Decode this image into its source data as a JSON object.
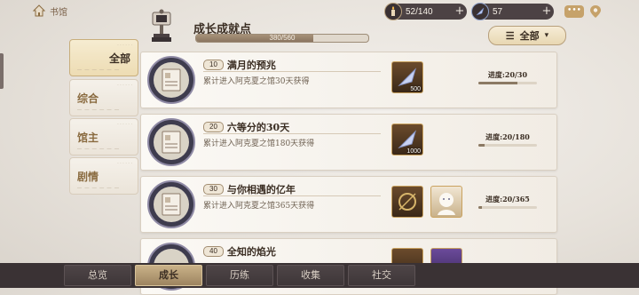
{
  "header": {
    "back_label": "书馆",
    "title": "成长成就点",
    "points_text": "380/560",
    "points_progress": 0.679,
    "filter_label": "全部"
  },
  "resources": [
    {
      "icon": "candle-icon",
      "value": "52/140"
    },
    {
      "icon": "feather-crystal-icon",
      "value": "57"
    }
  ],
  "chat_label": "•••",
  "tabs": [
    {
      "label": "全部",
      "active": true
    },
    {
      "label": "综合",
      "active": false
    },
    {
      "label": "馆主",
      "active": false
    },
    {
      "label": "剧情",
      "active": false
    }
  ],
  "achievements": [
    {
      "points": "10",
      "name": "满月的预兆",
      "desc": "累计进入阿克夏之馆30天获得",
      "rewards": [
        {
          "icon": "crystal-feather-icon",
          "amount": "500"
        }
      ],
      "progress_text": "进度:20/30",
      "progress": 0.667
    },
    {
      "points": "20",
      "name": "六等分的30天",
      "desc": "累计进入阿克夏之馆180天获得",
      "rewards": [
        {
          "icon": "crystal-feather-icon",
          "amount": "1000"
        }
      ],
      "progress_text": "进度:20/180",
      "progress": 0.111
    },
    {
      "points": "30",
      "name": "与你相遇的亿年",
      "desc": "累计进入阿克夏之馆365天获得",
      "rewards": [
        {
          "icon": "frame-icon",
          "amount": ""
        },
        {
          "icon": "avatar-icon",
          "amount": ""
        }
      ],
      "progress_text": "进度:20/365",
      "progress": 0.055
    },
    {
      "points": "40",
      "name": "全知的焰光",
      "desc": "",
      "rewards": [
        {
          "icon": "reward-icon",
          "amount": ""
        },
        {
          "icon": "reward-icon",
          "amount": ""
        }
      ],
      "progress_text": "",
      "progress": 0
    }
  ],
  "nav": [
    {
      "label": "总览",
      "active": false
    },
    {
      "label": "成长",
      "active": true
    },
    {
      "label": "历练",
      "active": false
    },
    {
      "label": "收集",
      "active": false
    },
    {
      "label": "社交",
      "active": false
    }
  ]
}
